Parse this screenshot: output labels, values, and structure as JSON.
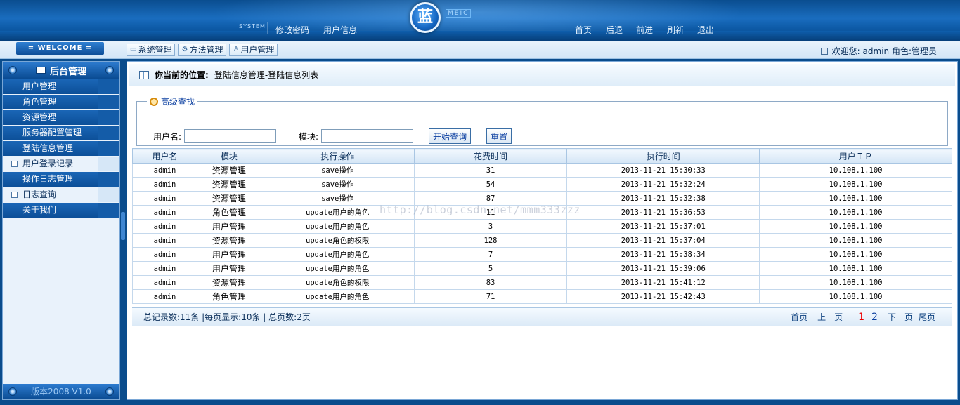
{
  "header": {
    "system_tag": "SYSTEM",
    "left_links": [
      "修改密码",
      "用户信息"
    ],
    "logo_char": "蓝",
    "logo_sub": "MEIC",
    "right_links": [
      "首页",
      "后退",
      "前进",
      "刷新",
      "退出"
    ]
  },
  "toolbar": {
    "welcome": "= WELCOME =",
    "tabs": [
      "系统管理",
      "方法管理",
      "用户管理"
    ],
    "user_info": "欢迎您: admin 角色:管理员"
  },
  "sidebar": {
    "title": "后台管理",
    "items": [
      {
        "label": "用户管理",
        "sub": false
      },
      {
        "label": "角色管理",
        "sub": false
      },
      {
        "label": "资源管理",
        "sub": false
      },
      {
        "label": "服务器配置管理",
        "sub": false
      },
      {
        "label": "登陆信息管理",
        "sub": false
      },
      {
        "label": "用户登录记录",
        "sub": true
      },
      {
        "label": "操作日志管理",
        "sub": false
      },
      {
        "label": "日志查询",
        "sub": true
      },
      {
        "label": "关于我们",
        "sub": false
      }
    ],
    "footer": "版本2008 V1.0"
  },
  "main": {
    "location_label": "你当前的位置:",
    "location_path": "登陆信息管理-登陆信息列表",
    "search": {
      "legend": "高级查找",
      "username_label": "用户名:",
      "username_value": "",
      "module_label": "模块:",
      "module_value": "",
      "search_button": "开始查询",
      "reset_button": "重置"
    },
    "table": {
      "headers": [
        "用户名",
        "模块",
        "执行操作",
        "花费时间",
        "执行时间",
        "用户ＩＰ"
      ],
      "rows": [
        [
          "admin",
          "资源管理",
          "save操作",
          "31",
          "2013-11-21 15:30:33",
          "10.108.1.100"
        ],
        [
          "admin",
          "资源管理",
          "save操作",
          "54",
          "2013-11-21 15:32:24",
          "10.108.1.100"
        ],
        [
          "admin",
          "资源管理",
          "save操作",
          "87",
          "2013-11-21 15:32:38",
          "10.108.1.100"
        ],
        [
          "admin",
          "角色管理",
          "update用户的角色",
          "11",
          "2013-11-21 15:36:53",
          "10.108.1.100"
        ],
        [
          "admin",
          "用户管理",
          "update用户的角色",
          "3",
          "2013-11-21 15:37:01",
          "10.108.1.100"
        ],
        [
          "admin",
          "资源管理",
          "update角色的权限",
          "128",
          "2013-11-21 15:37:04",
          "10.108.1.100"
        ],
        [
          "admin",
          "用户管理",
          "update用户的角色",
          "7",
          "2013-11-21 15:38:34",
          "10.108.1.100"
        ],
        [
          "admin",
          "用户管理",
          "update用户的角色",
          "5",
          "2013-11-21 15:39:06",
          "10.108.1.100"
        ],
        [
          "admin",
          "资源管理",
          "update角色的权限",
          "83",
          "2013-11-21 15:41:12",
          "10.108.1.100"
        ],
        [
          "admin",
          "角色管理",
          "update用户的角色",
          "71",
          "2013-11-21 15:42:43",
          "10.108.1.100"
        ]
      ]
    },
    "watermark": "http://blog.csdn.net/mmm333zzz",
    "pager": {
      "info": "总记录数:11条 |每页显示:10条 | 总页数:2页",
      "first": "首页",
      "prev": "上一页",
      "pages": [
        "1",
        "2"
      ],
      "current_page": "1",
      "next": "下一页",
      "last": "尾页"
    }
  }
}
